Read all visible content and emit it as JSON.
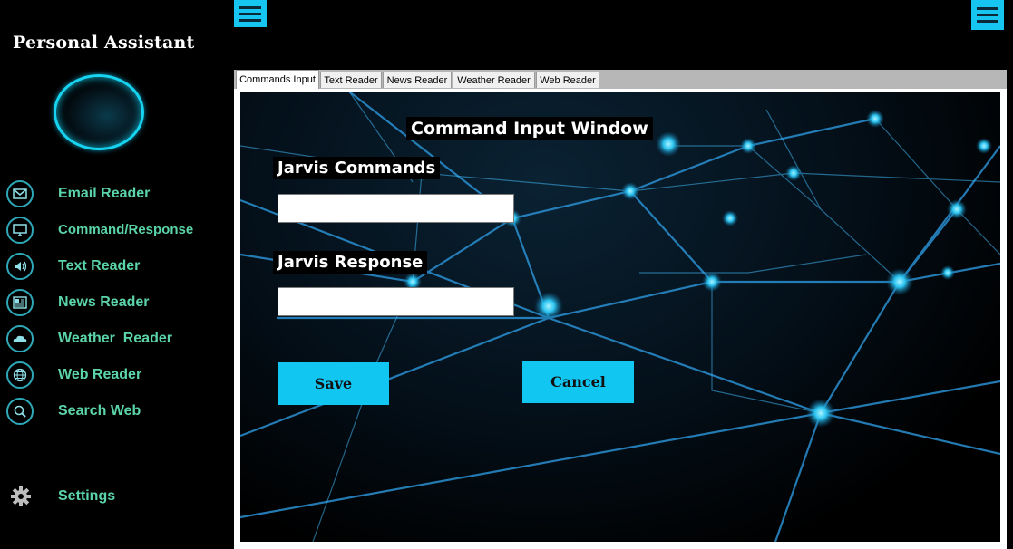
{
  "app": {
    "title": "Personal Assistant"
  },
  "sidebar": {
    "items": [
      {
        "label": "Email Reader",
        "icon": "mail-icon"
      },
      {
        "label": "Command/Response",
        "icon": "monitor-icon"
      },
      {
        "label": "Text Reader",
        "icon": "speaker-icon"
      },
      {
        "label": "News Reader",
        "icon": "newspaper-icon"
      },
      {
        "label": "Weather  Reader",
        "icon": "cloud-icon"
      },
      {
        "label": "Web Reader",
        "icon": "globe-icon"
      },
      {
        "label": "Search Web",
        "icon": "search-icon"
      }
    ],
    "settings": {
      "label": "Settings",
      "icon": "gear-icon"
    }
  },
  "tabs": [
    {
      "label": "Commands Input",
      "active": true
    },
    {
      "label": "Text Reader",
      "active": false
    },
    {
      "label": "News Reader",
      "active": false
    },
    {
      "label": "Weather Reader",
      "active": false
    },
    {
      "label": "Web Reader",
      "active": false
    }
  ],
  "panel": {
    "heading": "Command Input Window",
    "commands_label": "Jarvis Commands",
    "commands_value": "",
    "response_label": "Jarvis Response",
    "response_value": "",
    "save_label": "Save",
    "cancel_label": "Cancel"
  },
  "colors": {
    "accent": "#17c6f0",
    "nav_text": "#5ad4a8",
    "background": "#000000"
  }
}
